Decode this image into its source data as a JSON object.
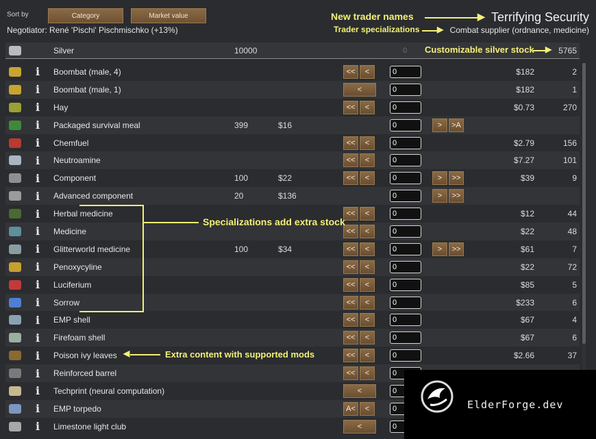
{
  "header": {
    "sort_by_label": "Sort by",
    "sort_buttons": [
      "Category",
      "Market value"
    ],
    "negotiator": "Negotiator: René 'Pischi' Pischmischko (+13%)",
    "trader_name": "Terrifying Security",
    "trader_specialization": "Combat supplier (ordnance, medicine)"
  },
  "annotations": {
    "new_trader_names": "New trader names",
    "trader_specializations": "Trader specializations",
    "customizable_silver": "Customizable silver stock",
    "specializations_extra": "Specializations add extra stock",
    "extra_content": "Extra content with supported mods"
  },
  "silver": {
    "name": "Silver",
    "colony_qty": "10000",
    "input": "0",
    "trader_qty": "5765"
  },
  "items": [
    {
      "name": "Boombat (male, 4)",
      "qty": "",
      "price": "",
      "left": [
        "<<",
        "<"
      ],
      "input": "0",
      "right": [],
      "tprice": "$182",
      "tqty": "2",
      "color": "#c9a431",
      "icon": "boombat-icon"
    },
    {
      "name": "Boombat (male, 1)",
      "qty": "",
      "price": "",
      "left": [
        "<"
      ],
      "input": "0",
      "right": [],
      "tprice": "$182",
      "tqty": "1",
      "color": "#c9a431",
      "icon": "boombat-icon"
    },
    {
      "name": "Hay",
      "qty": "",
      "price": "",
      "left": [
        "<<",
        "<"
      ],
      "input": "0",
      "right": [],
      "tprice": "$0.73",
      "tqty": "270",
      "color": "#9aa033",
      "icon": "hay-icon"
    },
    {
      "name": "Packaged survival meal",
      "qty": "399",
      "price": "$16",
      "left": [],
      "input": "0",
      "right": [
        ">",
        ">A"
      ],
      "tprice": "",
      "tqty": "",
      "color": "#3f8a3a",
      "icon": "meal-icon"
    },
    {
      "name": "Chemfuel",
      "qty": "",
      "price": "",
      "left": [
        "<<",
        "<"
      ],
      "input": "0",
      "right": [],
      "tprice": "$2.79",
      "tqty": "156",
      "color": "#b83a32",
      "icon": "chemfuel-icon"
    },
    {
      "name": "Neutroamine",
      "qty": "",
      "price": "",
      "left": [
        "<<",
        "<"
      ],
      "input": "0",
      "right": [],
      "tprice": "$7.27",
      "tqty": "101",
      "color": "#a9b6c2",
      "icon": "neutroamine-icon"
    },
    {
      "name": "Component",
      "qty": "100",
      "price": "$22",
      "left": [
        "<<",
        "<"
      ],
      "input": "0",
      "right": [
        ">",
        ">>"
      ],
      "tprice": "$39",
      "tqty": "9",
      "color": "#8f8f8f",
      "icon": "component-icon"
    },
    {
      "name": "Advanced component",
      "qty": "20",
      "price": "$136",
      "left": [],
      "input": "0",
      "right": [
        ">",
        ">>"
      ],
      "tprice": "",
      "tqty": "",
      "color": "#9b9b9b",
      "icon": "advanced-component-icon"
    },
    {
      "name": "Herbal medicine",
      "qty": "",
      "price": "",
      "left": [
        "<<",
        "<"
      ],
      "input": "0",
      "right": [],
      "tprice": "$12",
      "tqty": "44",
      "color": "#4a6a32",
      "icon": "herbal-medicine-icon"
    },
    {
      "name": "Medicine",
      "qty": "",
      "price": "",
      "left": [
        "<<",
        "<"
      ],
      "input": "0",
      "right": [],
      "tprice": "$22",
      "tqty": "48",
      "color": "#5e8f9a",
      "icon": "medicine-icon"
    },
    {
      "name": "Glitterworld medicine",
      "qty": "100",
      "price": "$34",
      "left": [
        "<<",
        "<"
      ],
      "input": "0",
      "right": [
        ">",
        ">>"
      ],
      "tprice": "$61",
      "tqty": "7",
      "color": "#8c9aa4",
      "icon": "glitterworld-medicine-icon"
    },
    {
      "name": "Penoxycyline",
      "qty": "",
      "price": "",
      "left": [
        "<<",
        "<"
      ],
      "input": "0",
      "right": [],
      "tprice": "$22",
      "tqty": "72",
      "color": "#c6a030",
      "icon": "penoxycyline-icon"
    },
    {
      "name": "Luciferium",
      "qty": "",
      "price": "",
      "left": [
        "<<",
        "<"
      ],
      "input": "0",
      "right": [],
      "tprice": "$85",
      "tqty": "5",
      "color": "#c23a3a",
      "icon": "luciferium-icon"
    },
    {
      "name": "Sorrow",
      "qty": "",
      "price": "",
      "left": [
        "<<",
        "<"
      ],
      "input": "0",
      "right": [],
      "tprice": "$233",
      "tqty": "6",
      "color": "#4f7fd0",
      "icon": "sorrow-icon"
    },
    {
      "name": "EMP shell",
      "qty": "",
      "price": "",
      "left": [
        "<<",
        "<"
      ],
      "input": "0",
      "right": [],
      "tprice": "$67",
      "tqty": "4",
      "color": "#8da0b0",
      "icon": "emp-shell-icon"
    },
    {
      "name": "Firefoam shell",
      "qty": "",
      "price": "",
      "left": [
        "<<",
        "<"
      ],
      "input": "0",
      "right": [],
      "tprice": "$67",
      "tqty": "6",
      "color": "#9ab0a0",
      "icon": "firefoam-shell-icon"
    },
    {
      "name": "Poison ivy leaves",
      "qty": "",
      "price": "",
      "left": [
        "<<",
        "<"
      ],
      "input": "0",
      "right": [],
      "tprice": "$2.66",
      "tqty": "37",
      "color": "#8a6a30",
      "icon": "poison-ivy-icon"
    },
    {
      "name": "Reinforced barrel",
      "qty": "",
      "price": "",
      "left": [
        "<<",
        "<"
      ],
      "input": "0",
      "right": [],
      "tprice": "",
      "tqty": "",
      "color": "#7a7a7a",
      "icon": "barrel-icon"
    },
    {
      "name": "Techprint (neural computation)",
      "qty": "",
      "price": "",
      "left": [
        "<"
      ],
      "input": "0",
      "right": [],
      "tprice": "",
      "tqty": "",
      "color": "#c8b890",
      "icon": "techprint-icon"
    },
    {
      "name": "EMP torpedo",
      "qty": "",
      "price": "",
      "left": [
        "A<",
        "<"
      ],
      "input": "0",
      "right": [],
      "tprice": "",
      "tqty": "",
      "color": "#7e96c0",
      "icon": "emp-torpedo-icon"
    },
    {
      "name": "Limestone light club",
      "qty": "",
      "price": "",
      "left": [
        "<"
      ],
      "input": "0",
      "right": [],
      "tprice": "",
      "tqty": "",
      "color": "#a8a8a8",
      "icon": "club-icon"
    }
  ],
  "watermark": {
    "text": "ElderForge.dev"
  }
}
